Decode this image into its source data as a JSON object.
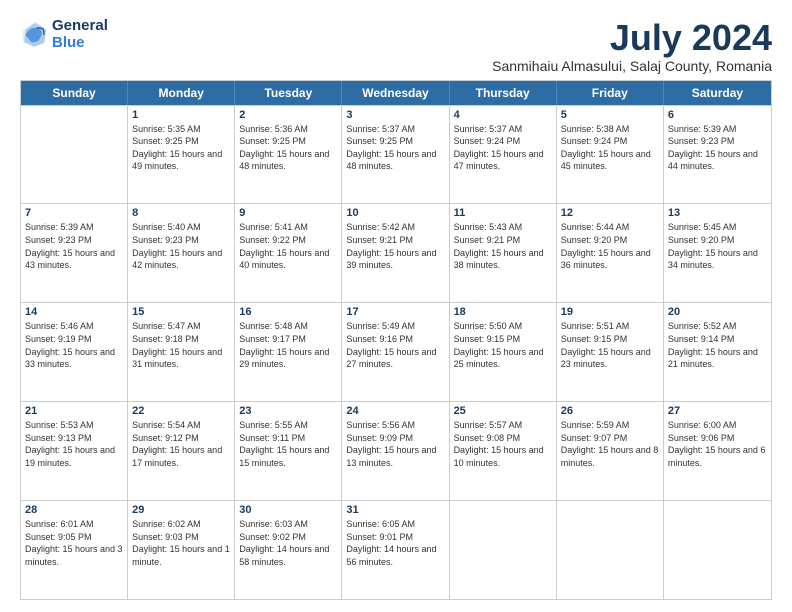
{
  "logo": {
    "general": "General",
    "blue": "Blue"
  },
  "title": {
    "month": "July 2024",
    "location": "Sanmihaiu Almasului, Salaj County, Romania"
  },
  "header_days": [
    "Sunday",
    "Monday",
    "Tuesday",
    "Wednesday",
    "Thursday",
    "Friday",
    "Saturday"
  ],
  "weeks": [
    [
      {
        "day": "",
        "sunrise": "",
        "sunset": "",
        "daylight": ""
      },
      {
        "day": "1",
        "sunrise": "Sunrise: 5:35 AM",
        "sunset": "Sunset: 9:25 PM",
        "daylight": "Daylight: 15 hours and 49 minutes."
      },
      {
        "day": "2",
        "sunrise": "Sunrise: 5:36 AM",
        "sunset": "Sunset: 9:25 PM",
        "daylight": "Daylight: 15 hours and 48 minutes."
      },
      {
        "day": "3",
        "sunrise": "Sunrise: 5:37 AM",
        "sunset": "Sunset: 9:25 PM",
        "daylight": "Daylight: 15 hours and 48 minutes."
      },
      {
        "day": "4",
        "sunrise": "Sunrise: 5:37 AM",
        "sunset": "Sunset: 9:24 PM",
        "daylight": "Daylight: 15 hours and 47 minutes."
      },
      {
        "day": "5",
        "sunrise": "Sunrise: 5:38 AM",
        "sunset": "Sunset: 9:24 PM",
        "daylight": "Daylight: 15 hours and 45 minutes."
      },
      {
        "day": "6",
        "sunrise": "Sunrise: 5:39 AM",
        "sunset": "Sunset: 9:23 PM",
        "daylight": "Daylight: 15 hours and 44 minutes."
      }
    ],
    [
      {
        "day": "7",
        "sunrise": "Sunrise: 5:39 AM",
        "sunset": "Sunset: 9:23 PM",
        "daylight": "Daylight: 15 hours and 43 minutes."
      },
      {
        "day": "8",
        "sunrise": "Sunrise: 5:40 AM",
        "sunset": "Sunset: 9:23 PM",
        "daylight": "Daylight: 15 hours and 42 minutes."
      },
      {
        "day": "9",
        "sunrise": "Sunrise: 5:41 AM",
        "sunset": "Sunset: 9:22 PM",
        "daylight": "Daylight: 15 hours and 40 minutes."
      },
      {
        "day": "10",
        "sunrise": "Sunrise: 5:42 AM",
        "sunset": "Sunset: 9:21 PM",
        "daylight": "Daylight: 15 hours and 39 minutes."
      },
      {
        "day": "11",
        "sunrise": "Sunrise: 5:43 AM",
        "sunset": "Sunset: 9:21 PM",
        "daylight": "Daylight: 15 hours and 38 minutes."
      },
      {
        "day": "12",
        "sunrise": "Sunrise: 5:44 AM",
        "sunset": "Sunset: 9:20 PM",
        "daylight": "Daylight: 15 hours and 36 minutes."
      },
      {
        "day": "13",
        "sunrise": "Sunrise: 5:45 AM",
        "sunset": "Sunset: 9:20 PM",
        "daylight": "Daylight: 15 hours and 34 minutes."
      }
    ],
    [
      {
        "day": "14",
        "sunrise": "Sunrise: 5:46 AM",
        "sunset": "Sunset: 9:19 PM",
        "daylight": "Daylight: 15 hours and 33 minutes."
      },
      {
        "day": "15",
        "sunrise": "Sunrise: 5:47 AM",
        "sunset": "Sunset: 9:18 PM",
        "daylight": "Daylight: 15 hours and 31 minutes."
      },
      {
        "day": "16",
        "sunrise": "Sunrise: 5:48 AM",
        "sunset": "Sunset: 9:17 PM",
        "daylight": "Daylight: 15 hours and 29 minutes."
      },
      {
        "day": "17",
        "sunrise": "Sunrise: 5:49 AM",
        "sunset": "Sunset: 9:16 PM",
        "daylight": "Daylight: 15 hours and 27 minutes."
      },
      {
        "day": "18",
        "sunrise": "Sunrise: 5:50 AM",
        "sunset": "Sunset: 9:15 PM",
        "daylight": "Daylight: 15 hours and 25 minutes."
      },
      {
        "day": "19",
        "sunrise": "Sunrise: 5:51 AM",
        "sunset": "Sunset: 9:15 PM",
        "daylight": "Daylight: 15 hours and 23 minutes."
      },
      {
        "day": "20",
        "sunrise": "Sunrise: 5:52 AM",
        "sunset": "Sunset: 9:14 PM",
        "daylight": "Daylight: 15 hours and 21 minutes."
      }
    ],
    [
      {
        "day": "21",
        "sunrise": "Sunrise: 5:53 AM",
        "sunset": "Sunset: 9:13 PM",
        "daylight": "Daylight: 15 hours and 19 minutes."
      },
      {
        "day": "22",
        "sunrise": "Sunrise: 5:54 AM",
        "sunset": "Sunset: 9:12 PM",
        "daylight": "Daylight: 15 hours and 17 minutes."
      },
      {
        "day": "23",
        "sunrise": "Sunrise: 5:55 AM",
        "sunset": "Sunset: 9:11 PM",
        "daylight": "Daylight: 15 hours and 15 minutes."
      },
      {
        "day": "24",
        "sunrise": "Sunrise: 5:56 AM",
        "sunset": "Sunset: 9:09 PM",
        "daylight": "Daylight: 15 hours and 13 minutes."
      },
      {
        "day": "25",
        "sunrise": "Sunrise: 5:57 AM",
        "sunset": "Sunset: 9:08 PM",
        "daylight": "Daylight: 15 hours and 10 minutes."
      },
      {
        "day": "26",
        "sunrise": "Sunrise: 5:59 AM",
        "sunset": "Sunset: 9:07 PM",
        "daylight": "Daylight: 15 hours and 8 minutes."
      },
      {
        "day": "27",
        "sunrise": "Sunrise: 6:00 AM",
        "sunset": "Sunset: 9:06 PM",
        "daylight": "Daylight: 15 hours and 6 minutes."
      }
    ],
    [
      {
        "day": "28",
        "sunrise": "Sunrise: 6:01 AM",
        "sunset": "Sunset: 9:05 PM",
        "daylight": "Daylight: 15 hours and 3 minutes."
      },
      {
        "day": "29",
        "sunrise": "Sunrise: 6:02 AM",
        "sunset": "Sunset: 9:03 PM",
        "daylight": "Daylight: 15 hours and 1 minute."
      },
      {
        "day": "30",
        "sunrise": "Sunrise: 6:03 AM",
        "sunset": "Sunset: 9:02 PM",
        "daylight": "Daylight: 14 hours and 58 minutes."
      },
      {
        "day": "31",
        "sunrise": "Sunrise: 6:05 AM",
        "sunset": "Sunset: 9:01 PM",
        "daylight": "Daylight: 14 hours and 56 minutes."
      },
      {
        "day": "",
        "sunrise": "",
        "sunset": "",
        "daylight": ""
      },
      {
        "day": "",
        "sunrise": "",
        "sunset": "",
        "daylight": ""
      },
      {
        "day": "",
        "sunrise": "",
        "sunset": "",
        "daylight": ""
      }
    ]
  ]
}
